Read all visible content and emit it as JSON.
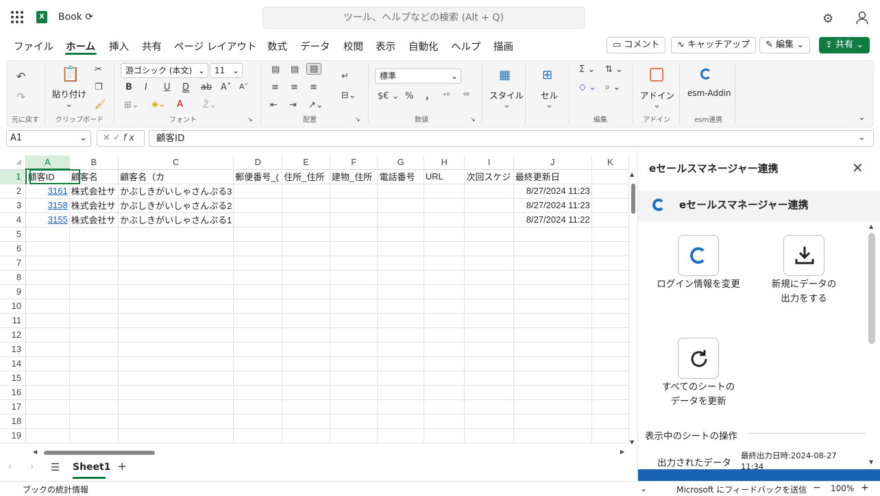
{
  "app": {
    "book_title": "Book",
    "search_placeholder": "ツール、ヘルプなどの検索 (Alt + Q)"
  },
  "menu": {
    "items": [
      "ファイル",
      "ホーム",
      "挿入",
      "共有",
      "ページ レイアウト",
      "数式",
      "データ",
      "校閲",
      "表示",
      "自動化",
      "ヘルプ",
      "描画"
    ],
    "comment": "コメント",
    "catchup": "キャッチアップ",
    "edit": "編集",
    "share": "共有"
  },
  "ribbon": {
    "undo_group": "元に戻す",
    "paste": "貼り付け",
    "clipboard_group": "クリップボード",
    "font_name": "游ゴシック (本文)",
    "font_size": "11",
    "font_group": "フォント",
    "align_group": "配置",
    "number_format": "標準",
    "number_group": "数値",
    "currency": "$€",
    "styles": "スタイル",
    "cells": "セル",
    "edit_group": "編集",
    "addin": "アドイン",
    "addin_group": "アドイン",
    "esm_addin": "esm-Addin",
    "esm_group": "esm連携"
  },
  "formula_bar": {
    "name_box": "A1",
    "formula": "顧客ID"
  },
  "grid": {
    "columns": [
      "A",
      "B",
      "C",
      "D",
      "E",
      "F",
      "G",
      "H",
      "I",
      "J",
      "K"
    ],
    "row_numbers": [
      "1",
      "2",
      "3",
      "4",
      "5",
      "6",
      "7",
      "8",
      "9",
      "10",
      "11",
      "12",
      "13",
      "14",
      "15",
      "16",
      "17",
      "18",
      "19"
    ],
    "rows": [
      [
        "顧客ID",
        "顧客名",
        "顧客名（カ",
        "郵便番号_(",
        "住所_住所",
        "建物_住所",
        "電話番号",
        "URL",
        "次回スケジ",
        "最終更新日",
        ""
      ],
      [
        "3161",
        "株式会社サ",
        "かぶしきがいしゃさんぷる3",
        "",
        "",
        "",
        "",
        "",
        "",
        "8/27/2024 11:23",
        ""
      ],
      [
        "3158",
        "株式会社サ",
        "かぶしきがいしゃさんぷる2",
        "",
        "",
        "",
        "",
        "",
        "",
        "8/27/2024 11:23",
        ""
      ],
      [
        "3155",
        "株式会社サ",
        "かぶしきがいしゃさんぷる1",
        "",
        "",
        "",
        "",
        "",
        "",
        "8/27/2024 11:22",
        ""
      ]
    ]
  },
  "sheets": {
    "active": "Sheet1"
  },
  "status": {
    "left": "ブックの統計情報",
    "feedback": "Microsoft にフィードバックを送信",
    "zoom": "100%"
  },
  "pane": {
    "title": "eセールスマネージャー連携",
    "header": "eセールスマネージャー連携",
    "btn_login": "ログイン情報を変更",
    "btn_export_1": "新規にデータの",
    "btn_export_2": "出力をする",
    "btn_refresh_1": "すべてのシートの",
    "btn_refresh_2": "データを更新",
    "ops_title": "表示中のシートの操作",
    "output_label": "出力されたデータ",
    "last_output_1": "最終出力日時:2024-08-27",
    "last_output_2": "11:34"
  }
}
